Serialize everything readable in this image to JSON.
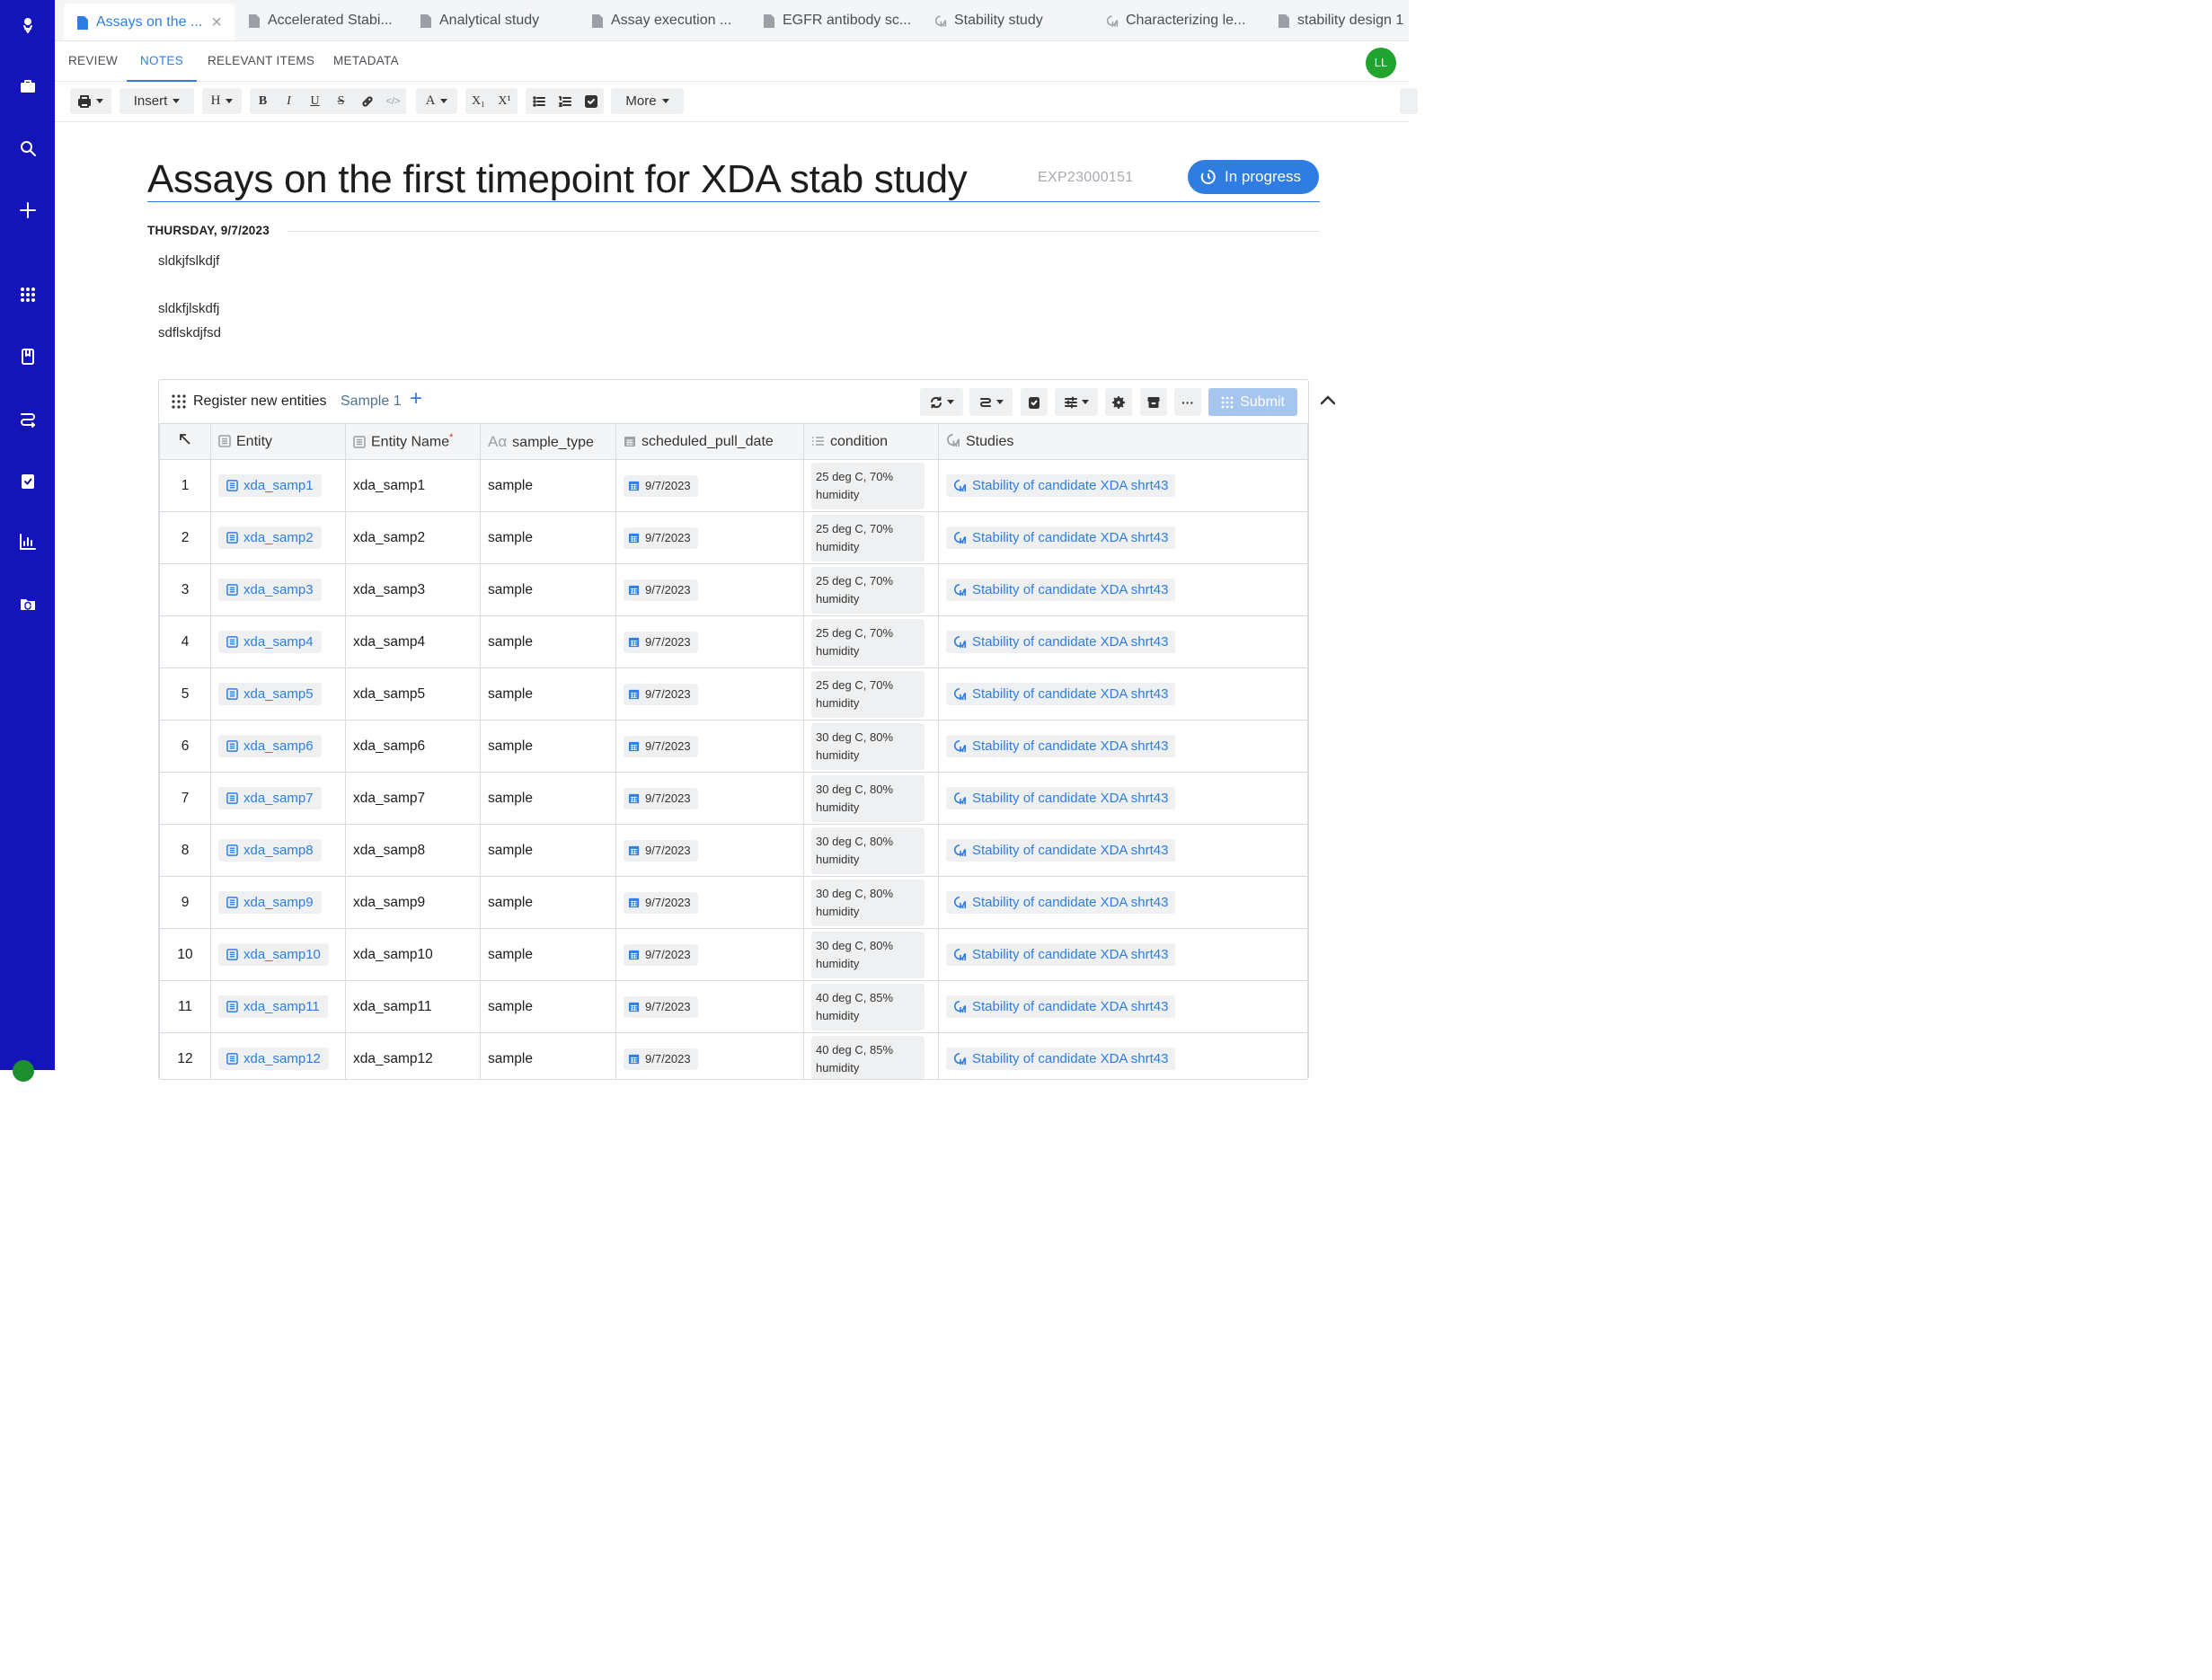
{
  "colors": {
    "rail": "#1414b8",
    "accent": "#2f7de1",
    "status_pill": "#2f7de1",
    "avatar": "#21a32f"
  },
  "rail": {
    "icons": [
      "benchling-logo-icon",
      "briefcase-icon",
      "search-icon",
      "plus-icon",
      "apps-grid-icon",
      "notebook-icon",
      "workflow-icon",
      "clipboard-check-icon",
      "bar-chart-icon",
      "folder-sync-icon"
    ]
  },
  "tabs": [
    {
      "label": "Assays on the ...",
      "icon": "document-icon",
      "active": true
    },
    {
      "label": "Accelerated Stabi...",
      "icon": "document-icon"
    },
    {
      "label": "Analytical study",
      "icon": "document-icon"
    },
    {
      "label": "Assay execution ...",
      "icon": "document-icon"
    },
    {
      "label": "EGFR antibody sc...",
      "icon": "document-icon"
    },
    {
      "label": "Stability study",
      "icon": "study-icon"
    },
    {
      "label": "Characterizing le...",
      "icon": "study-icon"
    },
    {
      "label": "stability design 1",
      "icon": "document-icon"
    }
  ],
  "subnav": {
    "items": [
      "REVIEW",
      "NOTES",
      "RELEVANT ITEMS",
      "METADATA"
    ],
    "active": "NOTES"
  },
  "user": {
    "initials": "LL"
  },
  "toolbar": {
    "insert_label": "Insert",
    "heading_label": "H",
    "bold": "B",
    "italic": "I",
    "underline": "U",
    "strike": "S",
    "text_color": "A",
    "subscript": "X₁",
    "superscript": "X¹",
    "more_label": "More"
  },
  "doc": {
    "title": "Assays on the first timepoint for XDA stab study",
    "id": "EXP23000151",
    "status": "In progress",
    "date_label": "THURSDAY, 9/7/2023",
    "notes": [
      "sldkjfslkdjf",
      "sldkfjlskdfj",
      "sdflskdjfsd"
    ]
  },
  "register": {
    "title": "Register new entities",
    "schema": "Sample 1",
    "submit_label": "Submit",
    "columns": [
      "Entity",
      "Entity Name",
      "sample_type",
      "scheduled_pull_date",
      "condition",
      "Studies"
    ],
    "required_marker": "*",
    "rows": [
      {
        "n": "1",
        "entity": "xda_samp1",
        "name": "xda_samp1",
        "type": "sample",
        "date": "9/7/2023",
        "condition": "25 deg C, 70% humidity",
        "study": "Stability of candidate XDA shrt43"
      },
      {
        "n": "2",
        "entity": "xda_samp2",
        "name": "xda_samp2",
        "type": "sample",
        "date": "9/7/2023",
        "condition": "25 deg C, 70% humidity",
        "study": "Stability of candidate XDA shrt43"
      },
      {
        "n": "3",
        "entity": "xda_samp3",
        "name": "xda_samp3",
        "type": "sample",
        "date": "9/7/2023",
        "condition": "25 deg C, 70% humidity",
        "study": "Stability of candidate XDA shrt43"
      },
      {
        "n": "4",
        "entity": "xda_samp4",
        "name": "xda_samp4",
        "type": "sample",
        "date": "9/7/2023",
        "condition": "25 deg C, 70% humidity",
        "study": "Stability of candidate XDA shrt43"
      },
      {
        "n": "5",
        "entity": "xda_samp5",
        "name": "xda_samp5",
        "type": "sample",
        "date": "9/7/2023",
        "condition": "25 deg C, 70% humidity",
        "study": "Stability of candidate XDA shrt43"
      },
      {
        "n": "6",
        "entity": "xda_samp6",
        "name": "xda_samp6",
        "type": "sample",
        "date": "9/7/2023",
        "condition": "30 deg C, 80% humidity",
        "study": "Stability of candidate XDA shrt43"
      },
      {
        "n": "7",
        "entity": "xda_samp7",
        "name": "xda_samp7",
        "type": "sample",
        "date": "9/7/2023",
        "condition": "30 deg C, 80% humidity",
        "study": "Stability of candidate XDA shrt43"
      },
      {
        "n": "8",
        "entity": "xda_samp8",
        "name": "xda_samp8",
        "type": "sample",
        "date": "9/7/2023",
        "condition": "30 deg C, 80% humidity",
        "study": "Stability of candidate XDA shrt43"
      },
      {
        "n": "9",
        "entity": "xda_samp9",
        "name": "xda_samp9",
        "type": "sample",
        "date": "9/7/2023",
        "condition": "30 deg C, 80% humidity",
        "study": "Stability of candidate XDA shrt43"
      },
      {
        "n": "10",
        "entity": "xda_samp10",
        "name": "xda_samp10",
        "type": "sample",
        "date": "9/7/2023",
        "condition": "30 deg C, 80% humidity",
        "study": "Stability of candidate XDA shrt43"
      },
      {
        "n": "11",
        "entity": "xda_samp11",
        "name": "xda_samp11",
        "type": "sample",
        "date": "9/7/2023",
        "condition": "40 deg C, 85% humidity",
        "study": "Stability of candidate XDA shrt43"
      },
      {
        "n": "12",
        "entity": "xda_samp12",
        "name": "xda_samp12",
        "type": "sample",
        "date": "9/7/2023",
        "condition": "40 deg C, 85% humidity",
        "study": "Stability of candidate XDA shrt43"
      }
    ]
  }
}
